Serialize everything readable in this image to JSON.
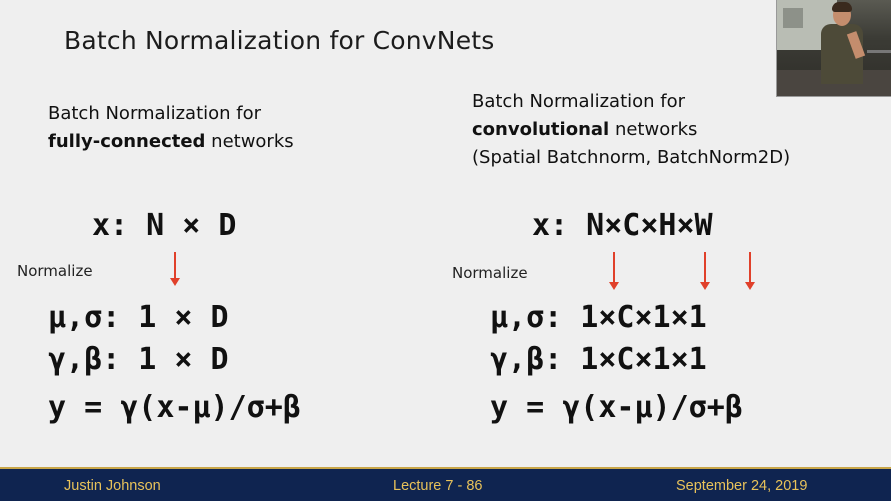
{
  "slide": {
    "title": "Batch Normalization for ConvNets",
    "left": {
      "heading_line1": "Batch Normalization for",
      "heading_bold": "fully-connected",
      "heading_rest": " networks",
      "x_shape": "x: N × D",
      "normalize_label": "Normalize",
      "mu_sigma": "μ,σ: 1 × D",
      "gamma_beta": "γ,β: 1 × D",
      "y_eq": "y = γ(x-μ)/σ+β"
    },
    "right": {
      "heading_line1": "Batch Normalization for",
      "heading_bold": "convolutional",
      "heading_rest": " networks",
      "heading_line3": "(Spatial Batchnorm, BatchNorm2D)",
      "x_shape": "x: N×C×H×W",
      "normalize_label": "Normalize",
      "mu_sigma": "μ,σ: 1×C×1×1",
      "gamma_beta": "γ,β: 1×C×1×1",
      "y_eq": "y = γ(x-μ)/σ+β"
    }
  },
  "footer": {
    "author": "Justin Johnson",
    "lecture": "Lecture 7 - 86",
    "date": "September 24, 2019"
  },
  "colors": {
    "footer_bg": "#0f2450",
    "footer_text": "#e8c25a",
    "arrow": "#e0402a"
  }
}
